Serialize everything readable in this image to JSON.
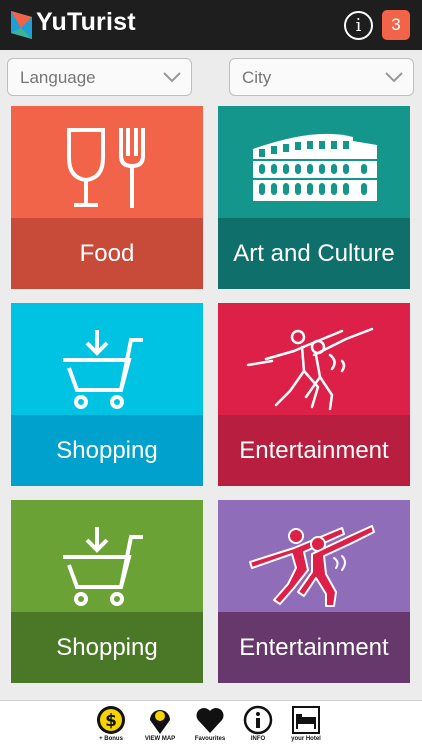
{
  "header": {
    "app_title": "YuTurist",
    "info_icon": "info-icon",
    "notification_count": "3"
  },
  "filters": {
    "language": "Language",
    "city": "City"
  },
  "tiles": [
    {
      "label": "Food",
      "icon": "glass-fork-icon",
      "top_color": "#f2644a",
      "bottom_color": "#c84a38"
    },
    {
      "label": "Art and Culture",
      "icon": "colosseum-icon",
      "top_color": "#14968c",
      "bottom_color": "#0f706b"
    },
    {
      "label": "Shopping",
      "icon": "cart-icon",
      "top_color": "#00c2e2",
      "bottom_color": "#00a1cd"
    },
    {
      "label": "Entertainment",
      "icon": "dancers-icon",
      "top_color": "#dd2047",
      "bottom_color": "#b81e3f"
    },
    {
      "label": "Shopping",
      "icon": "cart-icon",
      "top_color": "#6aa236",
      "bottom_color": "#4b7827"
    },
    {
      "label": "Entertainment",
      "icon": "dancers-icon",
      "top_color": "#8f6db9",
      "bottom_color": "#67386b"
    }
  ],
  "bottom_nav": [
    {
      "label": "+ Bonus",
      "icon": "dollar-coin-icon"
    },
    {
      "label": "VIEW MAP",
      "icon": "map-pin-icon"
    },
    {
      "label": "Favourites",
      "icon": "heart-icon"
    },
    {
      "label": "INFO",
      "icon": "info-icon"
    },
    {
      "label": "your Hotel",
      "icon": "hotel-bed-icon"
    }
  ]
}
